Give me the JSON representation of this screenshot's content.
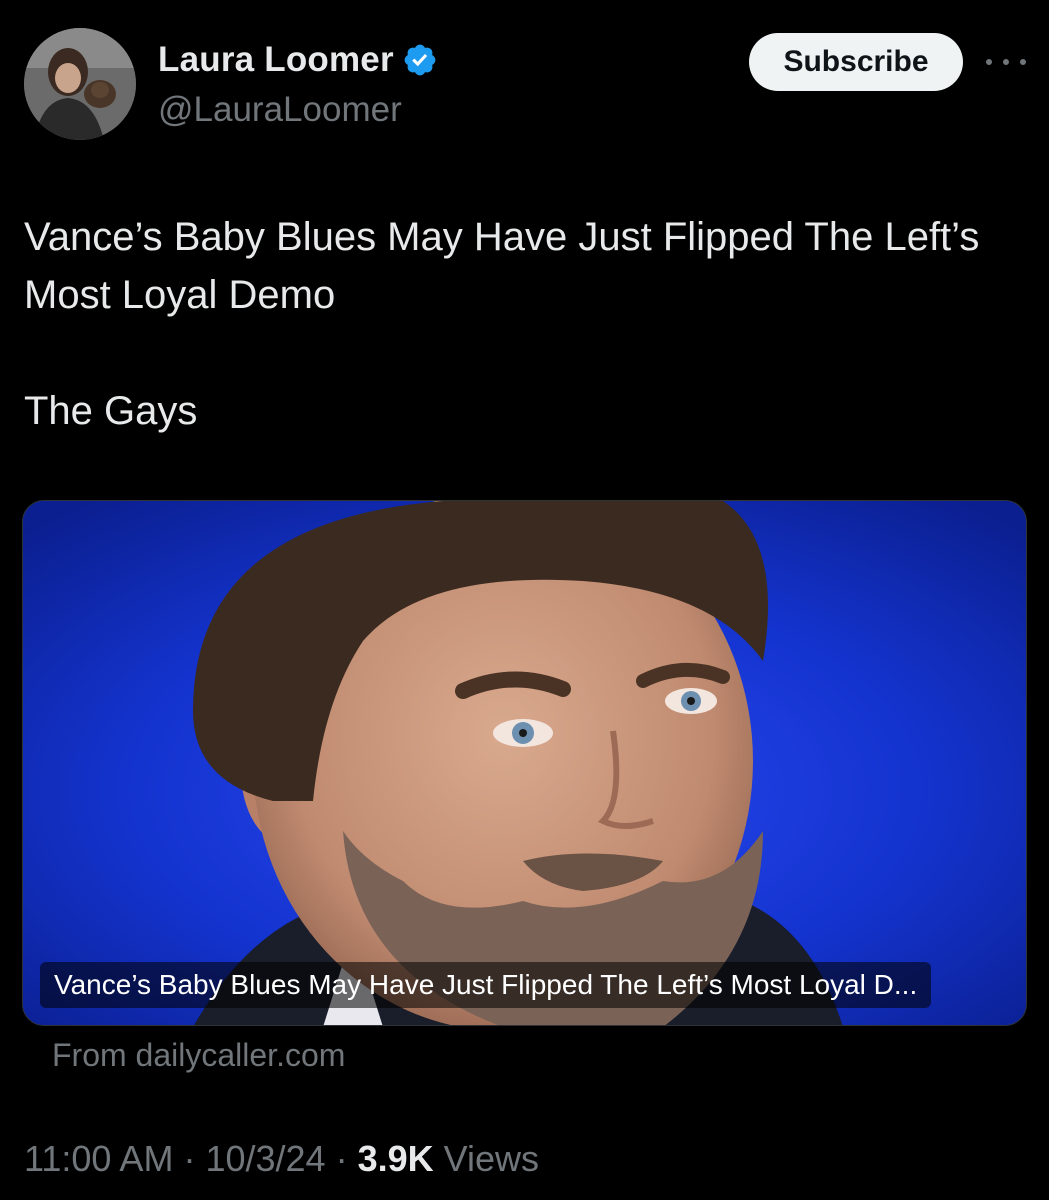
{
  "author": {
    "display_name": "Laura Loomer",
    "handle": "@LauraLoomer",
    "verified_icon": "verified-badge-icon",
    "verified_color": "#1d9bf0"
  },
  "actions": {
    "subscribe_label": "Subscribe",
    "more_icon": "more-horizontal-icon"
  },
  "tweet": {
    "text_line1": "Vance’s Baby Blues May Have Just Flipped The Left’s Most Loyal Demo",
    "text_line2": "The Gays"
  },
  "card": {
    "caption": "Vance’s Baby Blues May Have Just Flipped The Left’s Most Loyal D...",
    "source": "From dailycaller.com",
    "background_color": "#1233c8"
  },
  "meta": {
    "time": "11:00 AM",
    "separator": " · ",
    "date": "10/3/24",
    "views_count": "3.9K",
    "views_label": " Views"
  }
}
